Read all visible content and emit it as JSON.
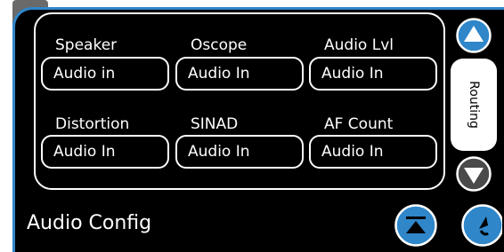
{
  "config": {
    "title": "Audio Config",
    "side_tab_label": "Routing",
    "fields": [
      {
        "label": "Speaker",
        "value": "Audio in"
      },
      {
        "label": "Oscope",
        "value": "Audio In"
      },
      {
        "label": "Audio Lvl",
        "value": "Audio In"
      },
      {
        "label": "Distortion",
        "value": "Audio In"
      },
      {
        "label": "SINAD",
        "value": "Audio In"
      },
      {
        "label": "AF Count",
        "value": "Audio In"
      }
    ]
  },
  "icons": {
    "scroll_up": "triangle-up-icon",
    "scroll_down": "triangle-down-icon",
    "collapse": "collapse-top-icon",
    "back": "return-icon"
  },
  "colors": {
    "accent": "#2f86c9",
    "scroll_down_fill": "#4a4a4a",
    "background": "#000000",
    "foreground": "#ffffff"
  }
}
